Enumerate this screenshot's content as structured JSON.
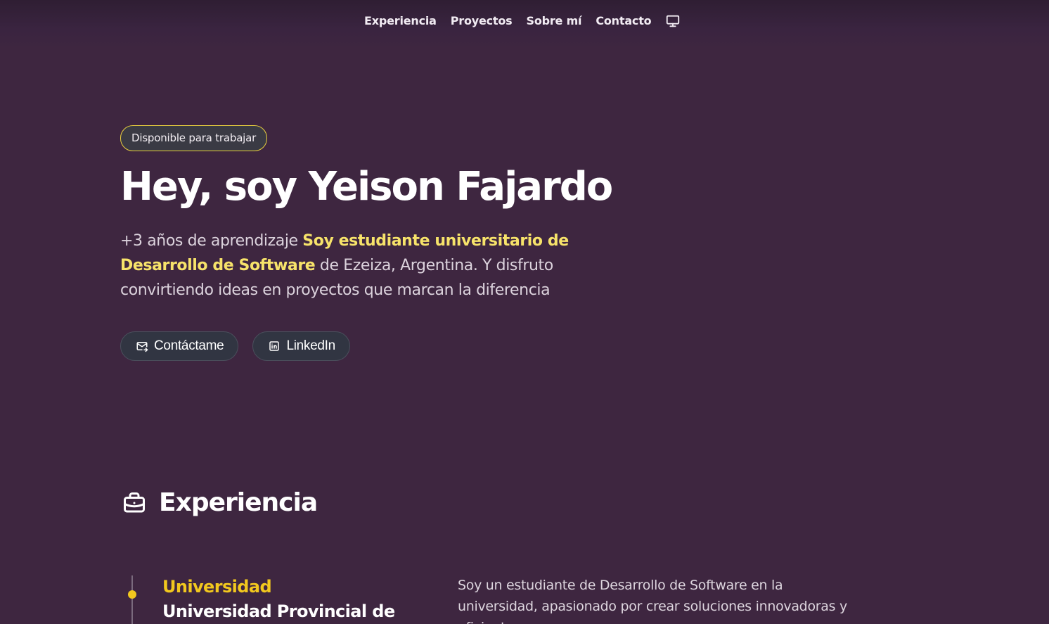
{
  "nav": {
    "items": [
      "Experiencia",
      "Proyectos",
      "Sobre mí",
      "Contacto"
    ],
    "theme_icon": "monitor-icon"
  },
  "hero": {
    "badge": "Disponible para trabajar",
    "title": "Hey, soy Yeison Fajardo",
    "desc_part1": "+3 años de aprendizaje ",
    "desc_highlight": "Soy estudiante universitario de Desarrollo de Software",
    "desc_part2": " de Ezeiza, Argentina. Y disfruto convirtiendo ideas en proyectos que marcan la diferencia",
    "buttons": [
      {
        "label": "Contáctame",
        "icon": "mail-icon"
      },
      {
        "label": "LinkedIn",
        "icon": "linkedin-icon"
      }
    ]
  },
  "experience": {
    "heading": "Experiencia",
    "heading_icon": "briefcase-icon",
    "entries": [
      {
        "role": "Universidad",
        "org": "Universidad Provincial de",
        "description": "Soy un estudiante de Desarrollo de Software en la universidad, apasionado por crear soluciones innovadoras y eficientes."
      }
    ]
  },
  "colors": {
    "background": "#3e2640",
    "accent": "#f2c81e",
    "highlight": "#f7e36a",
    "button_bg": "#313542"
  }
}
